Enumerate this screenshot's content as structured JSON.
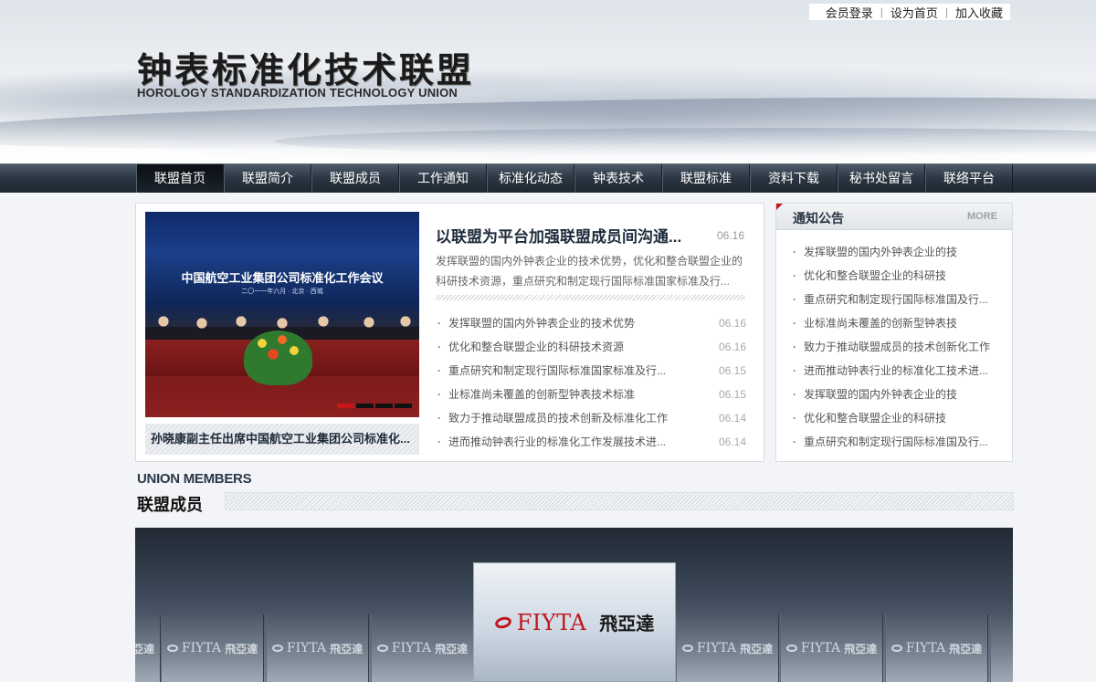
{
  "toplinks": [
    "会员登录",
    "设为首页",
    "加入收藏"
  ],
  "logo": {
    "cn": "钟表标准化技术联盟",
    "en": "HOROLOGY STANDARDIZATION TECHNOLOGY UNION"
  },
  "nav": [
    {
      "label": "联盟首页",
      "active": true
    },
    {
      "label": "联盟简介"
    },
    {
      "label": "联盟成员"
    },
    {
      "label": "工作通知"
    },
    {
      "label": "标准化动态"
    },
    {
      "label": "钟表技术"
    },
    {
      "label": "联盟标准"
    },
    {
      "label": "资料下载"
    },
    {
      "label": "秘书处留言"
    },
    {
      "label": "联络平台"
    }
  ],
  "slideshow": {
    "banner": "中国航空工业集团公司标准化工作会议",
    "banner_sub": "二〇一一年六月 · 北京 · 西城",
    "caption": "孙晓康副主任出席中国航空工业集团公司标准化...",
    "active_dot": 0,
    "dots": 4
  },
  "headline": {
    "title": "以联盟为平台加强联盟成员间沟通...",
    "date": "06.16",
    "summary": "发挥联盟的国内外钟表企业的技术优势，优化和整合联盟企业的科研技术资源，重点研究和制定现行国际标准国家标准及行..."
  },
  "news": [
    {
      "title": "发挥联盟的国内外钟表企业的技术优势",
      "date": "06.16"
    },
    {
      "title": "优化和整合联盟企业的科研技术资源",
      "date": "06.16"
    },
    {
      "title": "重点研究和制定现行国际标准国家标准及行...",
      "date": "06.15"
    },
    {
      "title": "业标准尚未覆盖的创新型钟表技术标准",
      "date": "06.15"
    },
    {
      "title": "致力于推动联盟成员的技术创新及标准化工作",
      "date": "06.14"
    },
    {
      "title": "进而推动钟表行业的标准化工作发展技术进...",
      "date": "06.14"
    }
  ],
  "notice": {
    "title": "通知公告",
    "more": "MORE",
    "items": [
      "发挥联盟的国内外钟表企业的技",
      "优化和整合联盟企业的科研技",
      "重点研究和制定现行国际标准国及行...",
      "业标准尚未覆盖的创新型钟表技",
      "致力于推动联盟成员的技术创新化工作",
      "进而推动钟表行业的标准化工技术进...",
      "发挥联盟的国内外钟表企业的技",
      "优化和整合联盟企业的科研技",
      "重点研究和制定现行国际标准国及行..."
    ]
  },
  "members": {
    "title_en": "UNION MEMBERS",
    "title_cn": "联盟成员",
    "feature": {
      "brand": "FIYTA",
      "cn": "飛亞達"
    },
    "tile_brand": "FIYTA",
    "tile_cn": "飛亞達"
  },
  "colors": {
    "accent_red": "#c8141b",
    "nav_dark": "#1f2832"
  }
}
